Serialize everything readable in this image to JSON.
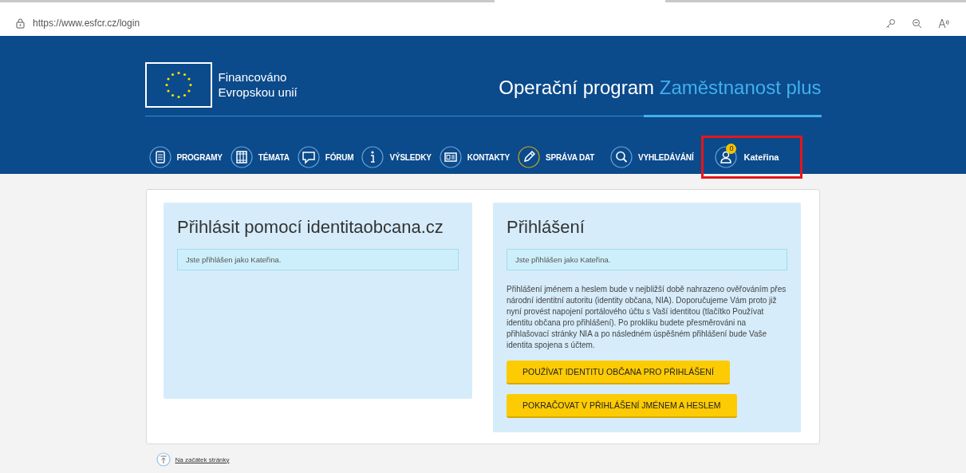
{
  "browser": {
    "url": "https://www.esfcr.cz/login"
  },
  "header": {
    "eu_label": [
      "Financováno",
      "Evropskou unií"
    ],
    "program_title": "Operační program",
    "program_name": "Zaměstnanost plus"
  },
  "nav": [
    {
      "label": "PROGRAMY",
      "selected": false
    },
    {
      "label": "TÉMATA",
      "selected": false
    },
    {
      "label": "FÓRUM",
      "selected": false
    },
    {
      "label": "VÝSLEDKY",
      "selected": false
    },
    {
      "label": "KONTAKTY",
      "selected": false
    },
    {
      "label": "SPRÁVA DAT",
      "selected": true
    }
  ],
  "search": {
    "label": "VYHLEDÁVÁNÍ"
  },
  "user": {
    "name": "Kateřina",
    "badge": "0",
    "highlighted": true
  },
  "identity_panel": {
    "title": "Přihlásit pomocí identitaobcana.cz",
    "notice": "Jste přihlášen jako Kateřina."
  },
  "login_panel": {
    "title": "Přihlášení",
    "notice": "Jste přihlášen jako Kateřina.",
    "text": "Přihlášení jménem a heslem bude v nejbližší době nahrazeno ověřováním přes národní identitní autoritu (identity občana, NIA). Doporučujeme Vám proto již nyní provést napojení portálového účtu s Vaší identitou (tlačítko Používat identitu občana pro přihlášení). Po prokliku budete přesměrováni na přihlašovací stránky NIA a po následném úspěšném přihlášení bude Vaše identita spojena s účtem.",
    "buttons": [
      "POUŽÍVAT IDENTITU OBČANA PRO PŘIHLÁŠENÍ",
      "POKRAČOVAT V PŘIHLÁŠENÍ JMÉNEM A HESLEM"
    ]
  },
  "footer": {
    "top_link": "Na začátek stránky"
  }
}
